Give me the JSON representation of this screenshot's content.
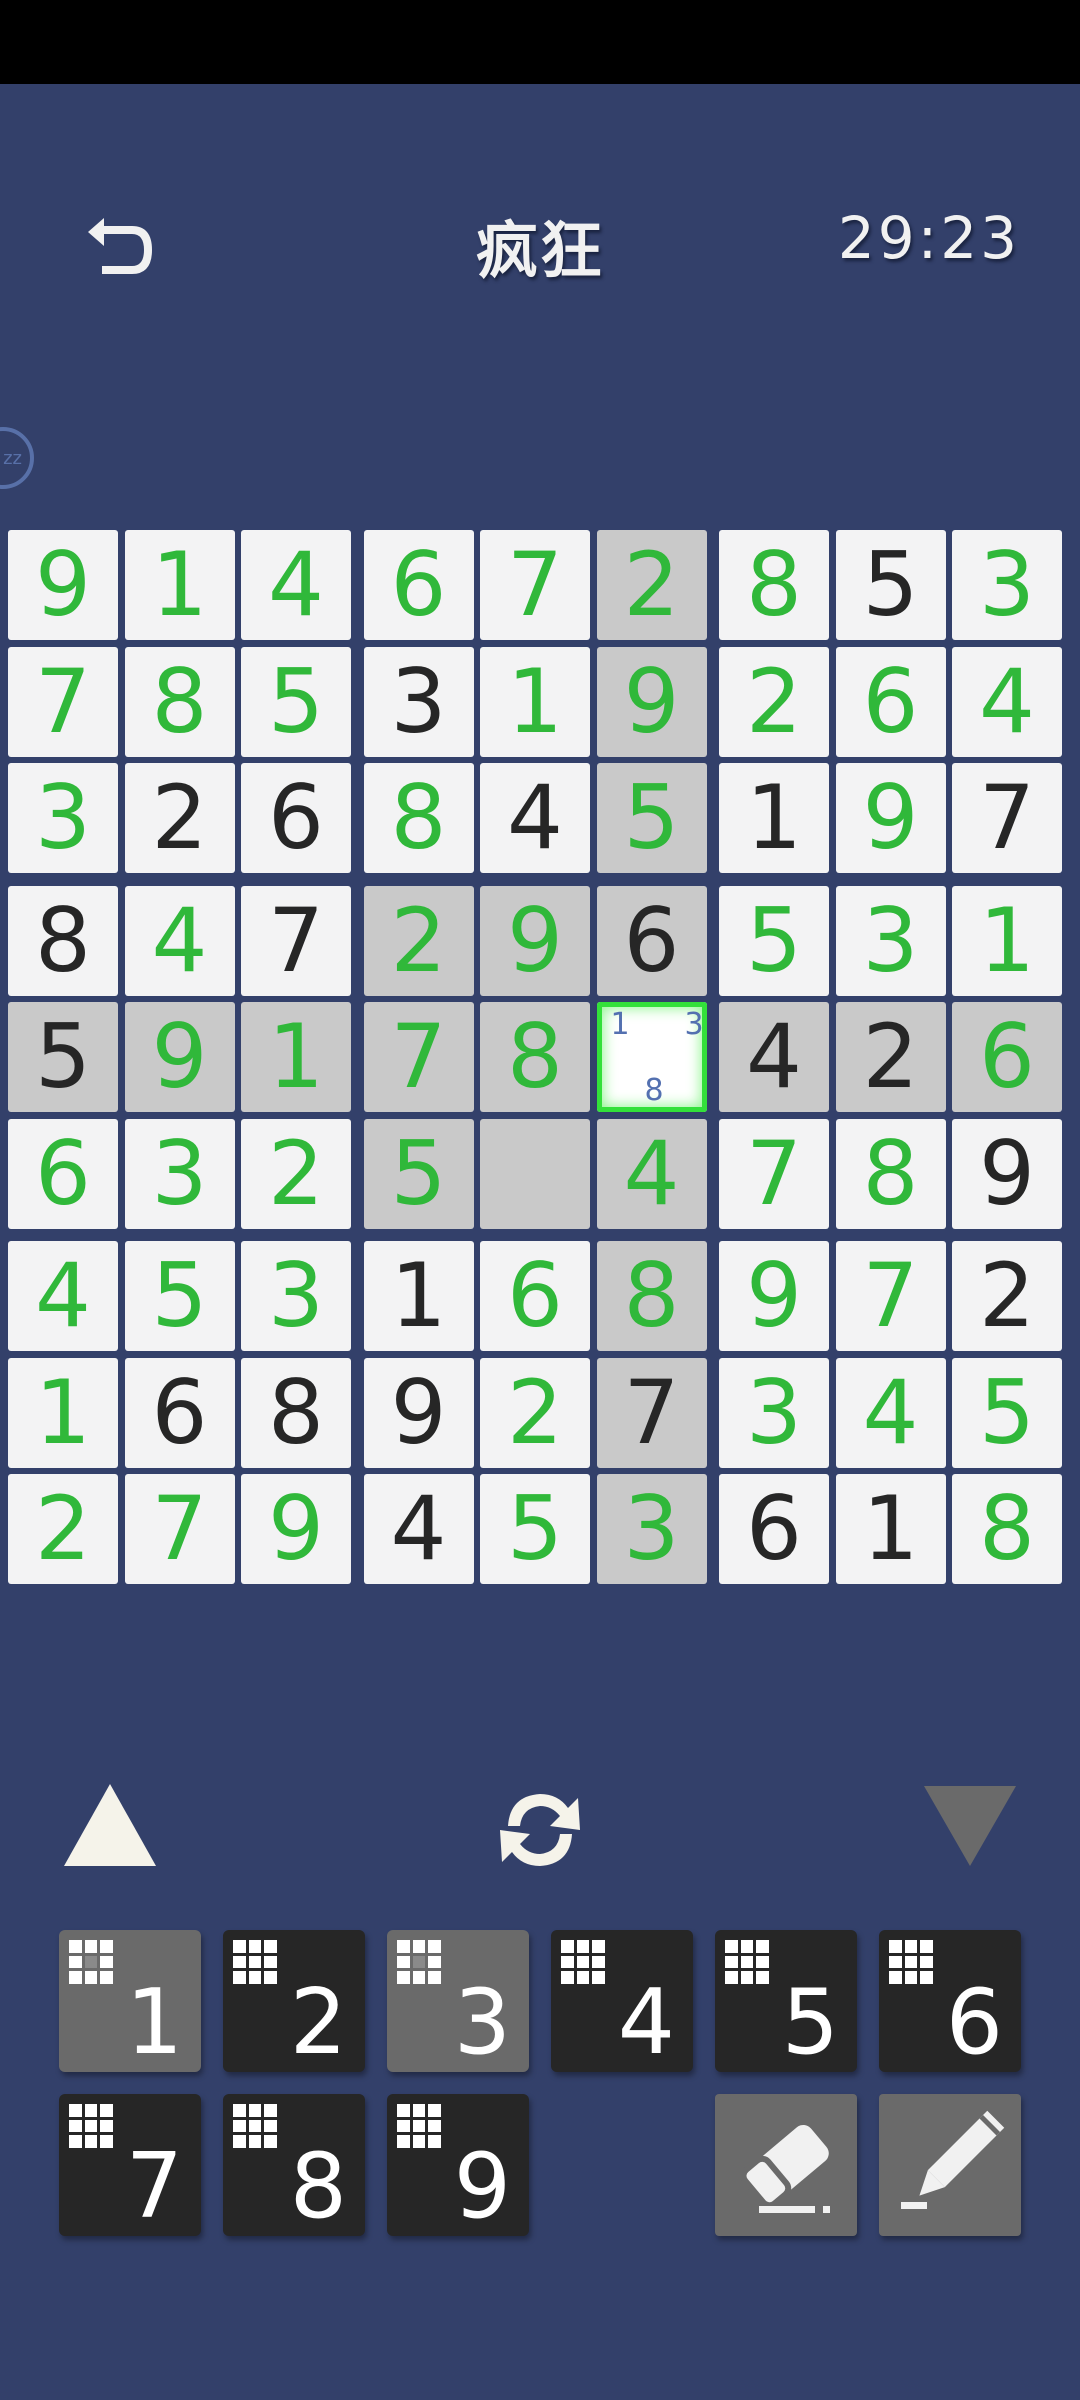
{
  "header": {
    "title": "疯狂",
    "timer": "29:23",
    "pause_label": "zz"
  },
  "board": {
    "rows": [
      [
        "9",
        "1",
        "4",
        "6",
        "7",
        "2",
        "8",
        "5",
        "3"
      ],
      [
        "7",
        "8",
        "5",
        "3",
        "1",
        "9",
        "2",
        "6",
        "4"
      ],
      [
        "3",
        "2",
        "6",
        "8",
        "4",
        "5",
        "1",
        "9",
        "7"
      ],
      [
        "8",
        "4",
        "7",
        "2",
        "9",
        "6",
        "5",
        "3",
        "1"
      ],
      [
        "5",
        "9",
        "1",
        "7",
        "8",
        "",
        "4",
        "2",
        "6"
      ],
      [
        "6",
        "3",
        "2",
        "5",
        "",
        "4",
        "7",
        "8",
        "9"
      ],
      [
        "4",
        "5",
        "3",
        "1",
        "6",
        "8",
        "9",
        "7",
        "2"
      ],
      [
        "1",
        "6",
        "8",
        "9",
        "2",
        "7",
        "3",
        "4",
        "5"
      ],
      [
        "2",
        "7",
        "9",
        "4",
        "5",
        "3",
        "6",
        "1",
        "8"
      ]
    ],
    "colors": [
      "gggggg g k g",
      "gggkgg ggg",
      "gkkgkg ggk",
      "kgkggk ggg",
      "kggggx kkg",
      "gggg.g ggk",
      "gggkgg ggk",
      "gkkkgk ggg",
      "gggkgg kkg"
    ],
    "selected_cell": {
      "row": 4,
      "col": 5
    },
    "selected_notes": [
      "1",
      "3",
      "8"
    ]
  },
  "controls": {
    "prev_label": "▲",
    "next_label": "▼"
  },
  "numpad": [
    {
      "label": "1",
      "used": true
    },
    {
      "label": "2",
      "used": false
    },
    {
      "label": "3",
      "used": true
    },
    {
      "label": "4",
      "used": false
    },
    {
      "label": "5",
      "used": false
    },
    {
      "label": "6",
      "used": false
    },
    {
      "label": "7",
      "used": false
    },
    {
      "label": "8",
      "used": false
    },
    {
      "label": "9",
      "used": false
    }
  ],
  "tools": {
    "eraser": "eraser-icon",
    "pencil": "pencil-icon"
  },
  "palette": {
    "background": "#33406a",
    "given": "#262626",
    "filled": "#30b83a",
    "highlight": "#c9c9c9",
    "selected_border": "#33e03a"
  }
}
